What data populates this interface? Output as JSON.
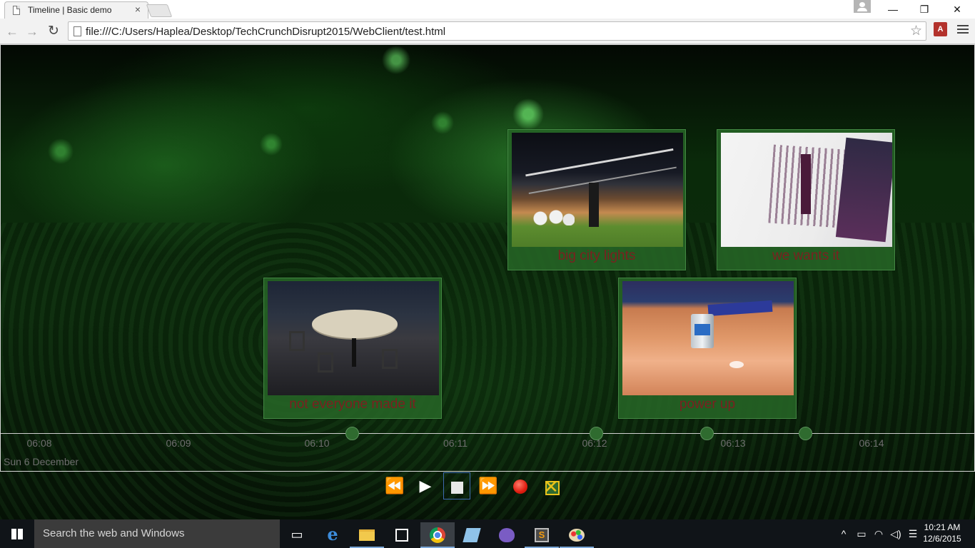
{
  "browser": {
    "tab_title": "Timeline | Basic demo",
    "url": "file:///C:/Users/Haplea/Desktop/TechCrunchDisrupt2015/WebClient/test.html",
    "controls": {
      "minimize": "—",
      "maximize": "❐",
      "close": "✕"
    }
  },
  "timeline": {
    "events": [
      {
        "caption": "big city lights",
        "time": "06:12"
      },
      {
        "caption": "we wants it",
        "time": "06:13"
      },
      {
        "caption": "not everyone made it",
        "time": "06:10"
      },
      {
        "caption": "power up",
        "time": "06:13"
      }
    ],
    "ticks": [
      "06:08",
      "06:09",
      "06:10",
      "06:11",
      "06:12",
      "06:13",
      "06:14"
    ],
    "date": "Sun 6 December"
  },
  "player": {
    "rewind": "⏪",
    "play": "▶",
    "forward": "⏩"
  },
  "taskbar": {
    "search_placeholder": "Search the web and Windows",
    "time": "10:21 AM",
    "date": "12/6/2015"
  }
}
